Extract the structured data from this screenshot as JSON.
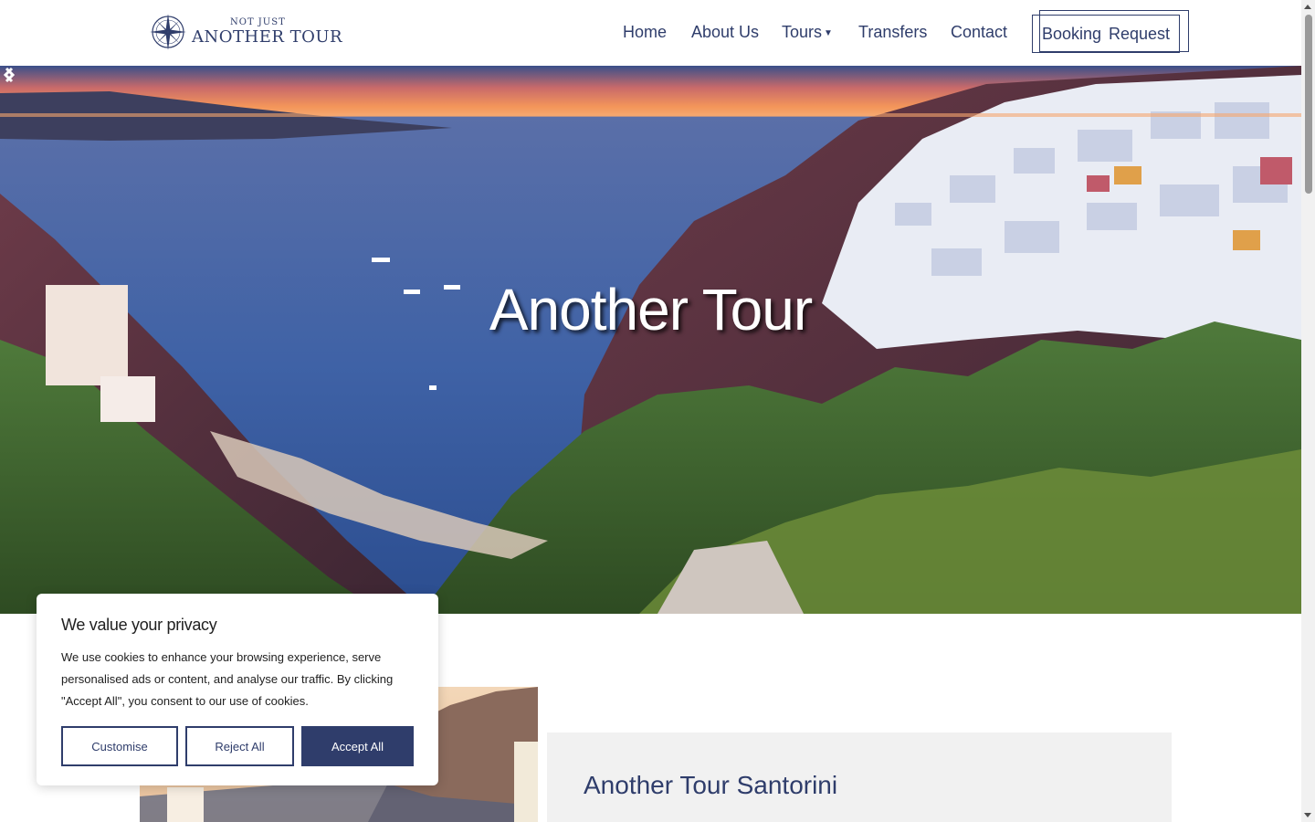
{
  "header": {
    "logo_small": "NOT JUST",
    "logo_big": "ANOTHER TOUR",
    "nav": [
      {
        "label": "Home"
      },
      {
        "label": "About Us"
      },
      {
        "label": "Tours"
      },
      {
        "label": "Transfers"
      },
      {
        "label": "Contact"
      }
    ],
    "booking_label": "Booking Request"
  },
  "hero": {
    "title": "Another Tour"
  },
  "card": {
    "title": "Another Tour Santorini"
  },
  "cookie": {
    "title": "We value your privacy",
    "text": "We use cookies to enhance your browsing experience, serve personalised ads or content, and analyse our traffic. By clicking \"Accept All\", you consent to our use of cookies.",
    "customise_label": "Customise",
    "reject_label": "Reject All",
    "accept_label": "Accept All"
  },
  "colors": {
    "brand": "#2f3d6b",
    "card_bg": "#f1f1f1"
  },
  "icons": {
    "logo": "compass-icon",
    "tours_caret": "chevron-down-icon",
    "prev": "chevron-left-icon",
    "next": "chevron-right-icon"
  }
}
